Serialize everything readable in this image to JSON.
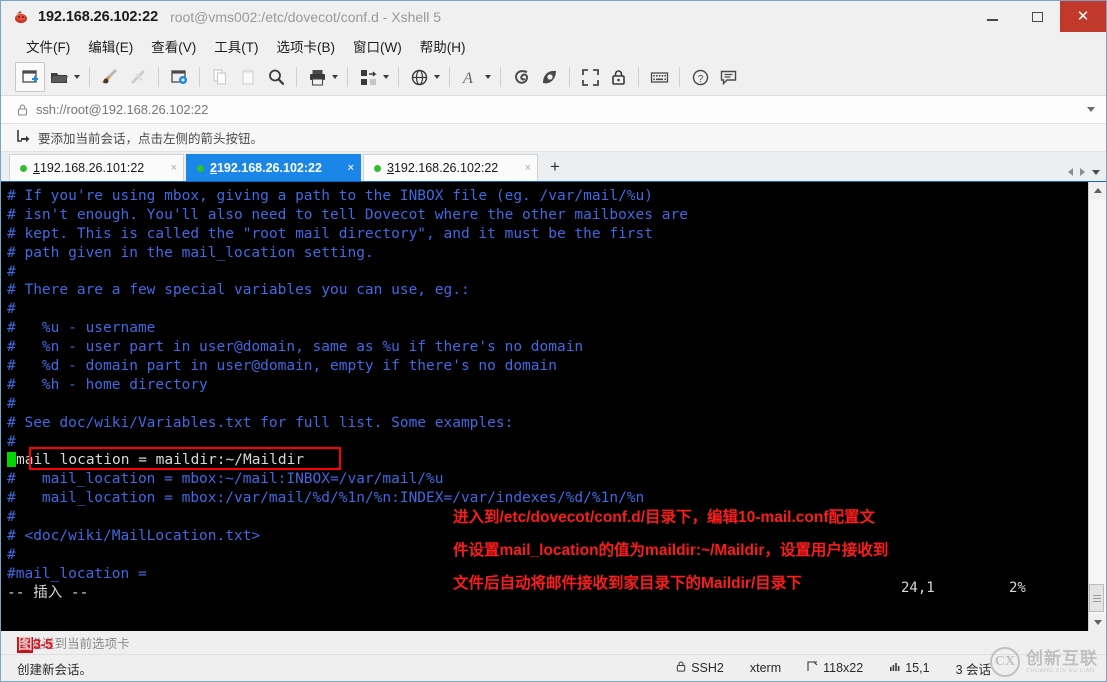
{
  "window": {
    "title_main": "192.168.26.102:22",
    "title_sub": "root@vms002:/etc/dovecot/conf.d - Xshell 5",
    "app_icon": "xshell-icon",
    "minimize_label": "—",
    "maximize_label": "□",
    "close_label": "✕"
  },
  "menu": {
    "items": [
      {
        "label": "文件(F)",
        "name": "menu-file"
      },
      {
        "label": "编辑(E)",
        "name": "menu-edit"
      },
      {
        "label": "查看(V)",
        "name": "menu-view"
      },
      {
        "label": "工具(T)",
        "name": "menu-tools"
      },
      {
        "label": "选项卡(B)",
        "name": "menu-tabs"
      },
      {
        "label": "窗口(W)",
        "name": "menu-window"
      },
      {
        "label": "帮助(H)",
        "name": "menu-help"
      }
    ]
  },
  "toolbar": {
    "icons": [
      "new-session-icon",
      "open-folder-icon",
      "quick-connect-icon",
      "disconnect-icon",
      "session-properties-icon",
      "copy-icon",
      "paste-icon",
      "find-icon",
      "print-icon",
      "transfer-icon",
      "web-icon",
      "font-icon",
      "ssh-tunnel-icon",
      "script-icon",
      "fullscreen-icon",
      "lock-icon",
      "keyboard-icon",
      "help-icon",
      "comment-icon"
    ]
  },
  "address": {
    "lock_icon": "lock-icon",
    "value": "ssh://root@192.168.26.102:22",
    "dropdown_icon": "chevron-down-icon"
  },
  "notice": {
    "icon": "add-session-arrow-icon",
    "text": "要添加当前会话，点击左侧的箭头按钮。"
  },
  "tabs": {
    "items": [
      {
        "num": "1",
        "label": " 192.168.26.101:22",
        "active": false,
        "status": "connected"
      },
      {
        "num": "2",
        "label": " 192.168.26.102:22",
        "active": true,
        "status": "connected"
      },
      {
        "num": "3",
        "label": " 192.168.26.102:22",
        "active": false,
        "status": "connected"
      }
    ],
    "add_label": "+",
    "close_label": "×"
  },
  "terminal": {
    "lines": [
      "# If you're using mbox, giving a path to the INBOX file (eg. /var/mail/%u)",
      "# isn't enough. You'll also need to tell Dovecot where the other mailboxes are",
      "# kept. This is called the \"root mail directory\", and it must be the first",
      "# path given in the mail_location setting.",
      "#",
      "# There are a few special variables you can use, eg.:",
      "#",
      "#   %u - username",
      "#   %n - user part in user@domain, same as %u if there's no domain",
      "#   %d - domain part in user@domain, empty if there's no domain",
      "#   %h - home directory",
      "#",
      "# See doc/wiki/Variables.txt for full list. Some examples:",
      "#"
    ],
    "highlighted_line": "mail location = maildir:~/Maildir",
    "lines_after": [
      "#   mail_location = mbox:~/mail:INBOX=/var/mail/%u",
      "#   mail_location = mbox:/var/mail/%d/%1n/%n:INDEX=/var/indexes/%d/%1n/%n",
      "#",
      "# <doc/wiki/MailLocation.txt>",
      "#",
      "#mail_location ="
    ],
    "mode_line": "-- 插入 --",
    "cursor_pos": "24,1",
    "scroll_pct": "2%",
    "comment_color": "#4169e1",
    "text_color": "#d8d8d8",
    "cursor_color": "#00d700",
    "highlight_box_color": "#ff0000"
  },
  "annotation": {
    "color": "#fb1d1d",
    "lines": [
      "进入到/etc/dovecot/conf.d/目录下，编辑10-mail.conf配置文",
      "件设置mail_location的值为maildir:~/Maildir，设置用户接收到",
      "文件后自动将邮件接收到家目录下的Maildir/目录下"
    ]
  },
  "infobar": {
    "text": "本发送到当前选项卡",
    "caption": "图3-5"
  },
  "statusbar": {
    "left_text": "创建新会话。",
    "protocol_icon": "lock-icon",
    "protocol": "SSH2",
    "terminal_type": "xterm",
    "size_icon": "resize-icon",
    "size": "118x22",
    "pos_icon": "columns-icon",
    "position": "15,1",
    "sessions": "3 会话"
  },
  "watermark": {
    "mark": "CX",
    "cn": "创新互联",
    "en": "CHUANG XIN HU LIAN"
  }
}
